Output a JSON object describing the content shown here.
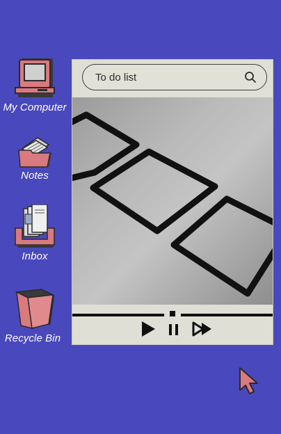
{
  "desktop": {
    "icons": [
      {
        "label": "My Computer",
        "icon": "computer-icon"
      },
      {
        "label": "Notes",
        "icon": "notes-folder-icon"
      },
      {
        "label": "Inbox",
        "icon": "inbox-tray-icon"
      },
      {
        "label": "Recycle Bin",
        "icon": "recycle-bin-icon"
      }
    ]
  },
  "player": {
    "search": {
      "value": "To do list",
      "icon": "search-icon"
    },
    "image": {
      "subject": "hand-drawn empty checkboxes on paper",
      "icon": "photo-checkboxes"
    },
    "progress": 0.5,
    "controls": [
      "play-icon",
      "pause-icon",
      "fast-forward-icon"
    ]
  },
  "colors": {
    "background": "#4a48bd",
    "window": "#dfdfd6",
    "icon_pink": "#d97a7f",
    "dark": "#2b2b2b"
  }
}
